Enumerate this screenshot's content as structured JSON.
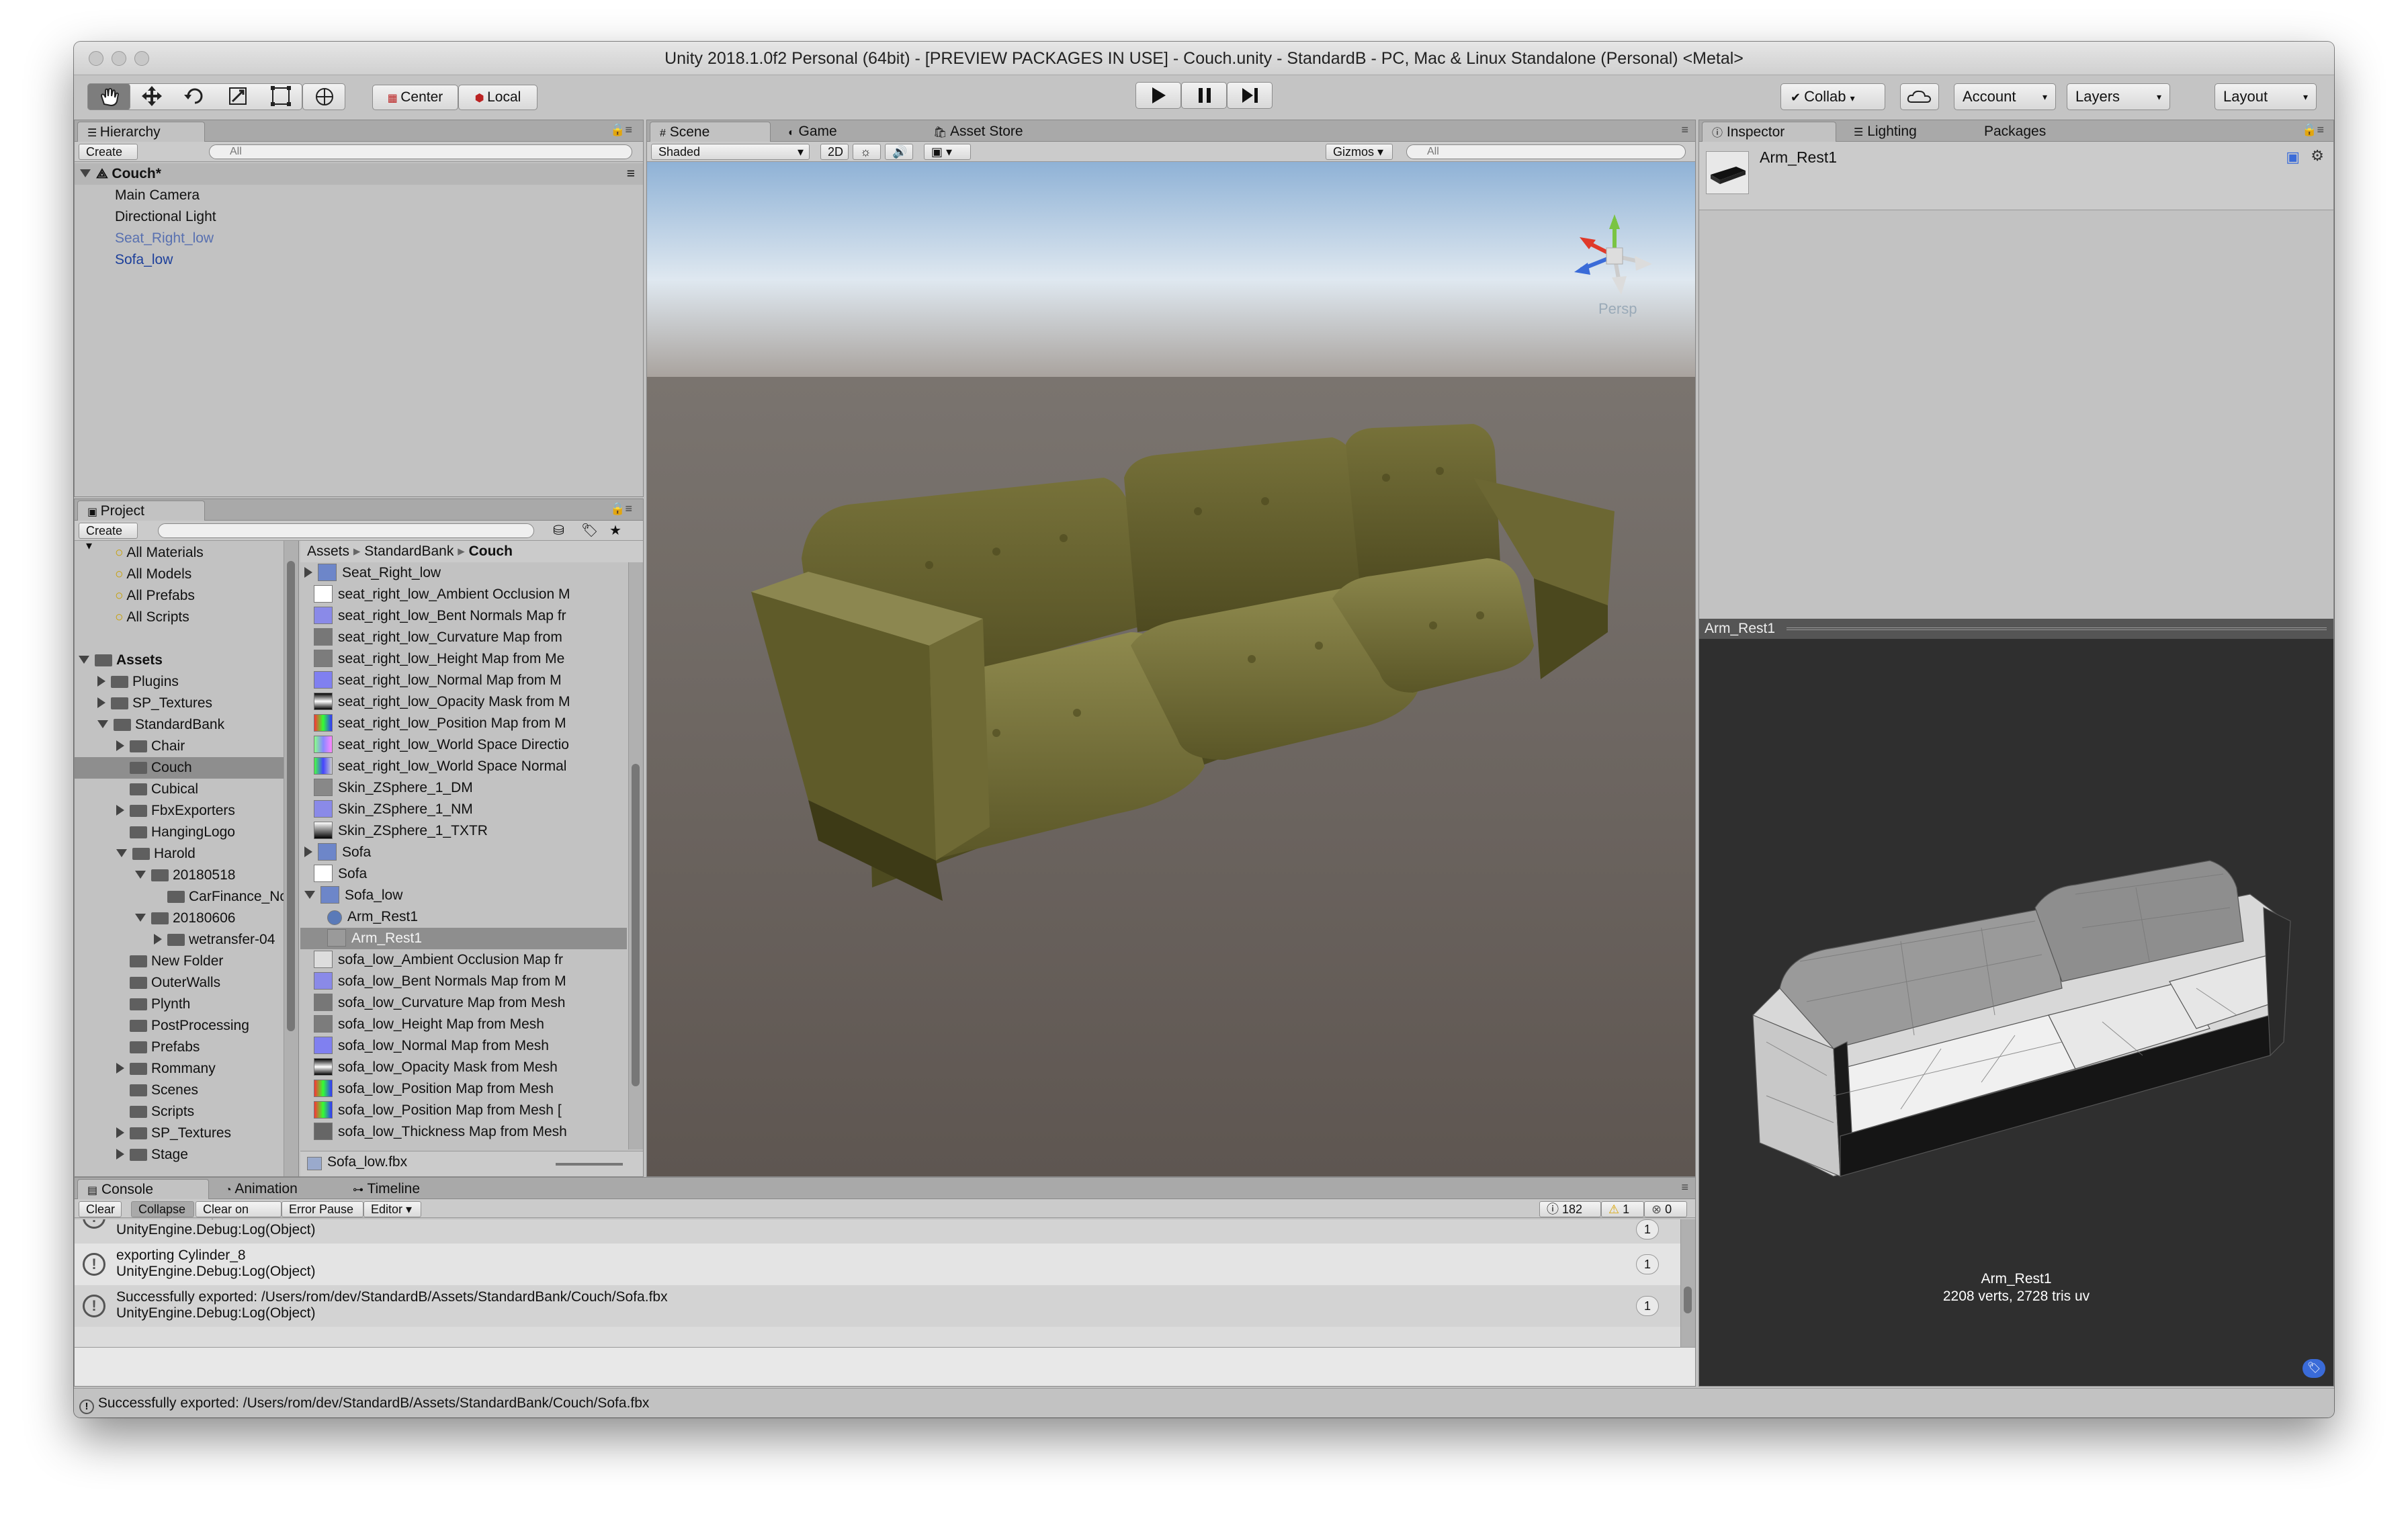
{
  "window": {
    "title": "Unity 2018.1.0f2 Personal (64bit) - [PREVIEW PACKAGES IN USE] - Couch.unity - StandardB - PC, Mac & Linux Standalone (Personal) <Metal>"
  },
  "toolbar": {
    "center_label": "Center",
    "local_label": "Local",
    "collab_label": "Collab",
    "account_label": "Account",
    "layers_label": "Layers",
    "layout_label": "Layout"
  },
  "hierarchy": {
    "tab": "Hierarchy",
    "create": "Create",
    "search_placeholder": "All",
    "scene": "Couch*",
    "items": [
      "Main Camera",
      "Directional Light",
      "Seat_Right_low",
      "Sofa_low"
    ]
  },
  "project": {
    "tab": "Project",
    "create": "Create",
    "favorites": [
      "All Materials",
      "All Models",
      "All Prefabs",
      "All Scripts"
    ],
    "tree": [
      "Assets",
      "Plugins",
      "SP_Textures",
      "StandardBank",
      "Chair",
      "Couch",
      "Cubical",
      "FbxExporters",
      "HangingLogo",
      "Harold",
      "20180518",
      "CarFinance_Nc",
      "20180606",
      "wetransfer-04",
      "New Folder",
      "OuterWalls",
      "Plynth",
      "PostProcessing",
      "Prefabs",
      "Rommany",
      "Scenes",
      "Scripts",
      "SP_Textures",
      "Stage"
    ],
    "breadcrumb": [
      "Assets",
      "StandardBank",
      "Couch"
    ],
    "files": [
      "Seat_Right_low",
      "seat_right_low_Ambient Occlusion M",
      "seat_right_low_Bent Normals Map fr",
      "seat_right_low_Curvature Map from",
      "seat_right_low_Height Map from Me",
      "seat_right_low_Normal Map from M",
      "seat_right_low_Opacity Mask from M",
      "seat_right_low_Position Map from M",
      "seat_right_low_World Space Directio",
      "seat_right_low_World Space Normal",
      "Skin_ZSphere_1_DM",
      "Skin_ZSphere_1_NM",
      "Skin_ZSphere_1_TXTR",
      "Sofa",
      "Sofa",
      "Sofa_low",
      "Arm_Rest1",
      "Arm_Rest1",
      "sofa_low_Ambient Occlusion Map fr",
      "sofa_low_Bent Normals Map from M",
      "sofa_low_Curvature Map from Mesh",
      "sofa_low_Height Map from Mesh",
      "sofa_low_Normal Map from Mesh",
      "sofa_low_Opacity Mask from Mesh",
      "sofa_low_Position Map from Mesh",
      "sofa_low_Position Map from Mesh [",
      "sofa_low_Thickness Map from Mesh"
    ],
    "selected_file": "Sofa_low.fbx"
  },
  "scene": {
    "tabs": [
      "Scene",
      "Game",
      "Asset Store"
    ],
    "shading": "Shaded",
    "mode2d": "2D",
    "gizmos": "Gizmos",
    "search_placeholder": "All",
    "persp": "Persp"
  },
  "inspector": {
    "tabs": [
      "Inspector",
      "Lighting",
      "Packages"
    ],
    "object": "Arm_Rest1",
    "preview_title": "Arm_Rest1",
    "preview_name": "Arm_Rest1",
    "preview_stats": "2208 verts, 2728 tris   uv"
  },
  "console": {
    "tabs": [
      "Console",
      "Animation",
      "Timeline"
    ],
    "buttons": [
      "Clear",
      "Collapse",
      "Clear on Play",
      "Error Pause",
      "Editor"
    ],
    "counts": {
      "info": "182",
      "warn": "1",
      "error": "0"
    },
    "logs": [
      {
        "line1": "exporting Cylinder_8",
        "line2": "UnityEngine.Debug:Log(Object)",
        "count": "1"
      },
      {
        "line1": "Successfully exported: /Users/rom/dev/StandardB/Assets/StandardBank/Couch/Sofa.fbx",
        "line2": "UnityEngine.Debug:Log(Object)",
        "count": "1"
      }
    ],
    "top_partial": "UnityEngine.Debug:Log(Object)",
    "top_count": "1"
  },
  "status": {
    "message": "Successfully exported: /Users/rom/dev/StandardB/Assets/StandardBank/Couch/Sofa.fbx"
  },
  "colors": {
    "sofa": "#5f5c2a",
    "sky": "#c6dbef",
    "ground": "#6e6660",
    "preview_bg": "#2f2f2f"
  }
}
